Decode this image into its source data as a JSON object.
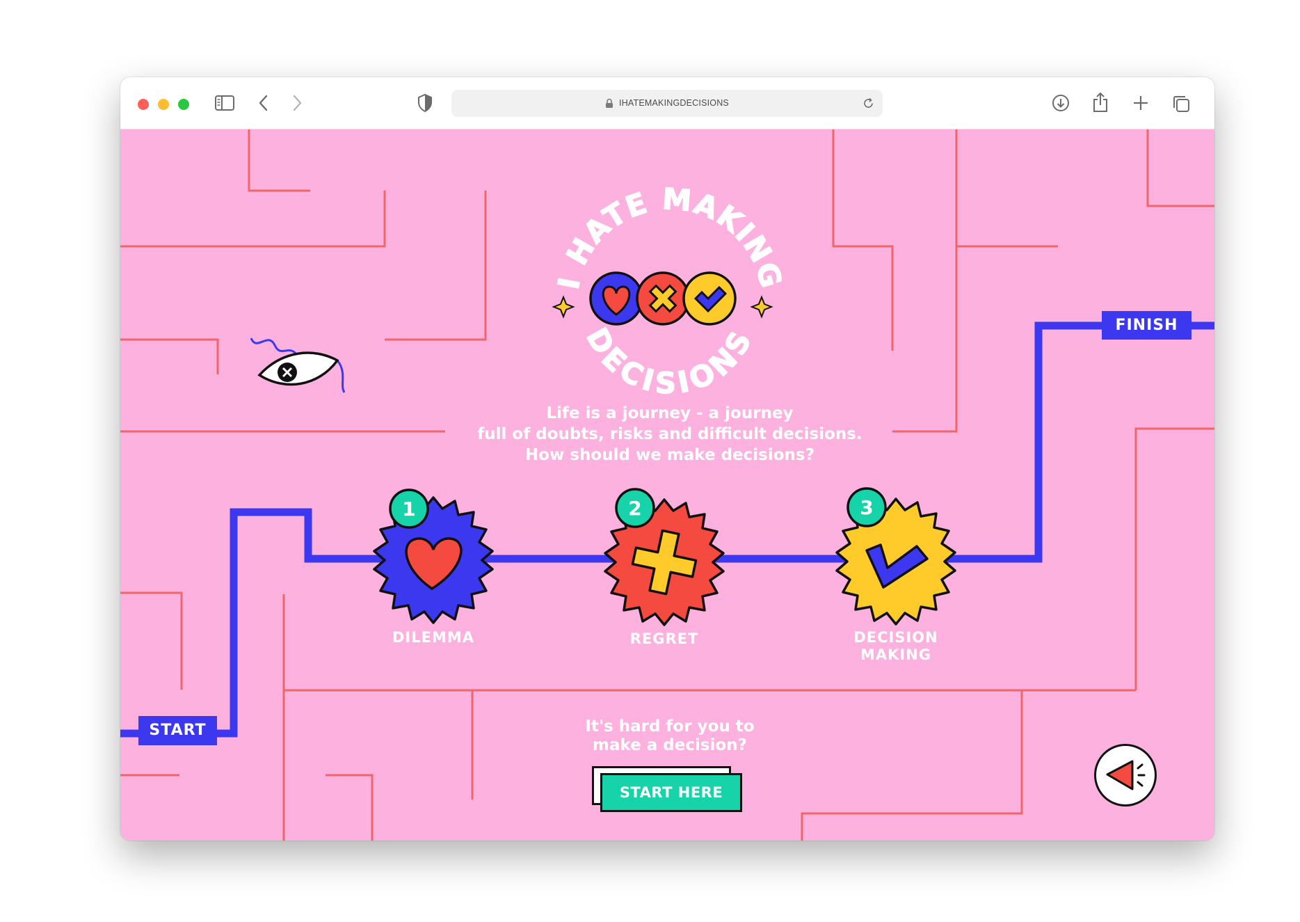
{
  "browser": {
    "url": "IHATEMAKINGDECISIONS",
    "traffic_lights": {
      "close": "#ff5f57",
      "minimize": "#febc2e",
      "zoom": "#28c840"
    }
  },
  "hero": {
    "logo_text_top": "I HATE MAKING",
    "logo_text_bottom": "DECISIONS",
    "intro_lines": [
      "Life is a journey - a journey",
      "full of doubts, risks and difficult decisions.",
      "How should we make decisions?"
    ]
  },
  "path": {
    "start_label": "START",
    "finish_label": "FINISH"
  },
  "steps": [
    {
      "number": "1",
      "label": "DILEMMA",
      "icon": "heart-icon",
      "color": "#3b38ef"
    },
    {
      "number": "2",
      "label": "REGRET",
      "icon": "cross-icon",
      "color": "#f44a3f"
    },
    {
      "number": "3",
      "label_lines": [
        "DECISION",
        "MAKING"
      ],
      "icon": "check-icon",
      "color": "#ffcb2a"
    }
  ],
  "cta": {
    "question_lines": [
      "It's hard for you to",
      "make a decision?"
    ],
    "button_label": "START HERE"
  },
  "colors": {
    "background": "#fcb1df",
    "maze_line": "#f0656a",
    "path": "#3b38ef",
    "accent_green": "#17d3a9",
    "accent_yellow": "#ffcb2a",
    "accent_red": "#f44a3f"
  }
}
